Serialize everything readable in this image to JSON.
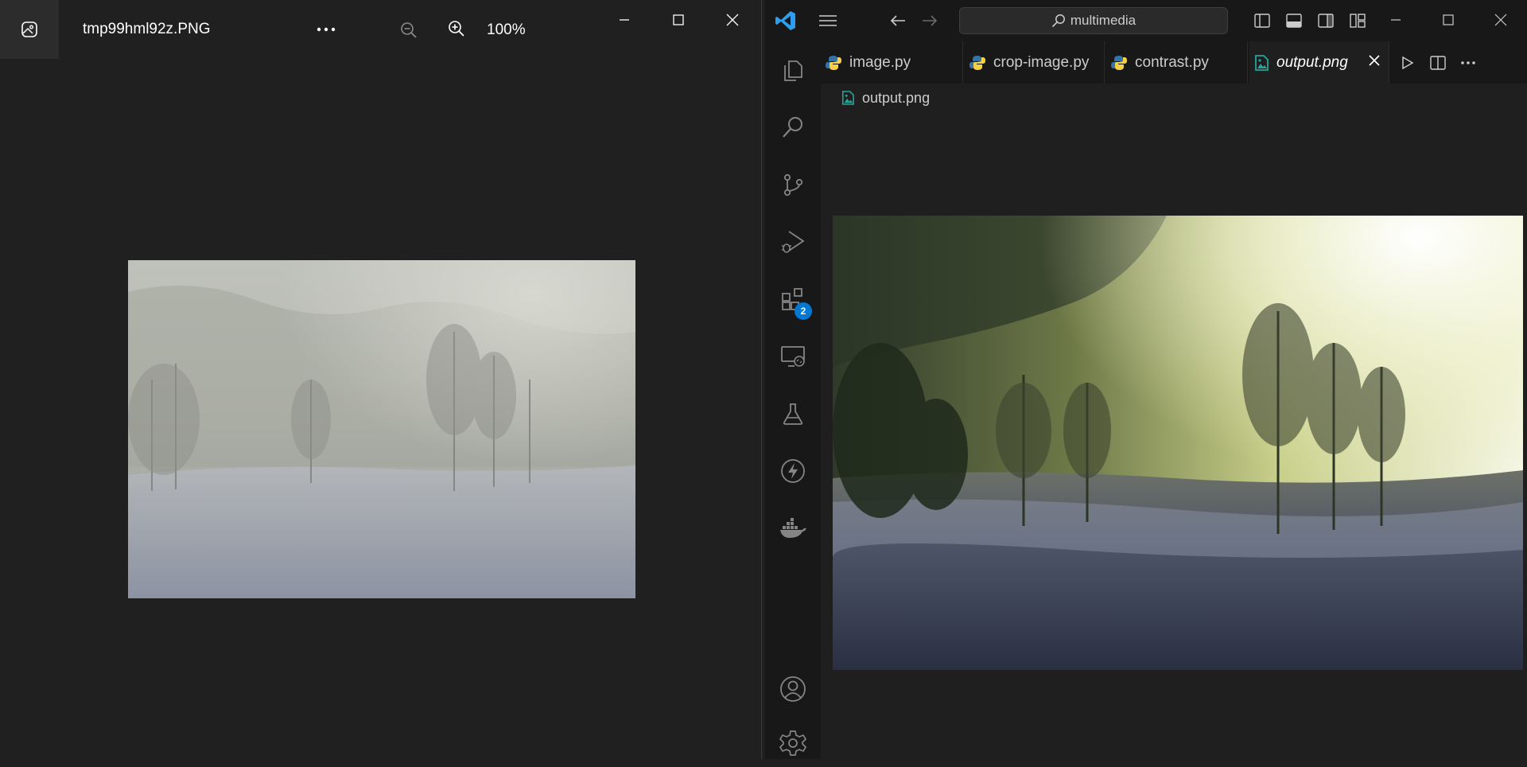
{
  "viewer": {
    "file_name": "tmp99hml92z.PNG",
    "zoom_level": "100%",
    "icons": {
      "app": "photos-app-icon",
      "more": "more-options-icon",
      "zoom_out": "zoom-out-icon",
      "zoom_in": "zoom-in-icon",
      "minimize": "minimize-icon",
      "maximize": "maximize-icon",
      "close": "close-icon"
    },
    "image_description": "foggy winter field with frosted birch trees (low contrast)"
  },
  "vscode": {
    "search_text": "multimedia",
    "tabs": [
      {
        "label": "image.py",
        "icon": "python-icon",
        "active": false
      },
      {
        "label": "crop-image.py",
        "icon": "python-icon",
        "active": false
      },
      {
        "label": "contrast.py",
        "icon": "python-icon",
        "active": false
      },
      {
        "label": "output.png",
        "icon": "image-file-icon",
        "active": true
      }
    ],
    "breadcrumb": "output.png",
    "extensions_badge": "2",
    "activity_bar": [
      "explorer-icon",
      "search-icon",
      "source-control-icon",
      "run-debug-icon",
      "extensions-icon",
      "remote-explorer-icon",
      "testing-icon",
      "lightning-icon",
      "docker-icon",
      "account-icon",
      "settings-gear-icon"
    ],
    "colors": {
      "accent": "#0078d4",
      "python_blue": "#3572a5",
      "python_yellow": "#f7d046",
      "image_icon": "#26a69a"
    }
  }
}
